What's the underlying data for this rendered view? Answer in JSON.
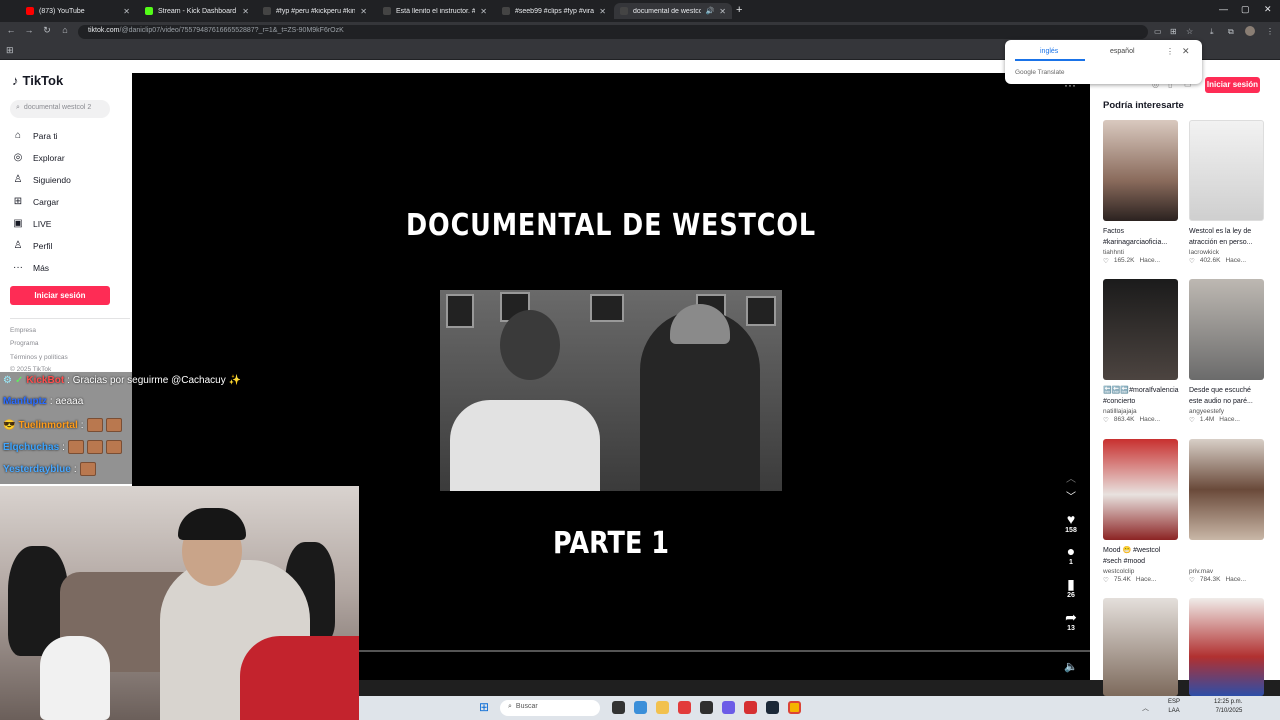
{
  "browser": {
    "tabs": [
      {
        "title": "(873) YouTube",
        "color": "#ff0000"
      },
      {
        "title": "Stream - Kick Dashboard",
        "color": "#53fc18"
      },
      {
        "title": "#fyp #peru #kickperu #kingtek",
        "color": "#111111"
      },
      {
        "title": "Está llenito el instructor. #fypp",
        "color": "#111111"
      },
      {
        "title": "#seeb99 #clips #fyp #viral #pe",
        "color": "#111111"
      },
      {
        "title": "documental de westcol #d",
        "color": "#111111"
      }
    ],
    "active_tab": 5,
    "url_host": "tiktok.com",
    "url_path": "/@daniclip07/video/7557948761666552887?_r=1&_t=ZS-90M9kF6rOzK"
  },
  "tiktok": {
    "logo": "TikTok",
    "search_placeholder": "documental westcol 2",
    "nav": [
      {
        "label": "Para ti",
        "icon": "home-icon"
      },
      {
        "label": "Explorar",
        "icon": "compass-icon"
      },
      {
        "label": "Siguiendo",
        "icon": "following-icon"
      },
      {
        "label": "Cargar",
        "icon": "upload-icon"
      },
      {
        "label": "LIVE",
        "icon": "live-icon"
      },
      {
        "label": "Perfil",
        "icon": "profile-icon"
      },
      {
        "label": "Más",
        "icon": "more-icon"
      }
    ],
    "login_label": "Iniciar sesión",
    "footer": [
      "Empresa",
      "Programa",
      "Términos y políticas",
      "© 2025 TikTok"
    ],
    "video": {
      "title": "DOCUMENTAL DE WESTCOL",
      "subtitle": "PARTE 1",
      "likes": "158",
      "comments": "1",
      "saves": "26",
      "shares": "13"
    },
    "suggest_heading": "Podría interesarte",
    "cards": [
      {
        "title": "Factos #karinagarciaoficia...",
        "user": "tiahhnti",
        "likes": "165.2K",
        "ago": "Hace...",
        "color": "#8a6b5c"
      },
      {
        "title": "Westcol es la ley de atracción en perso...",
        "user": "lacrowkick",
        "likes": "402.6K",
        "ago": "Hace...",
        "color": "#e6e6e6"
      },
      {
        "title": "🔚🔚🔚#moraIfvalencia #concierto",
        "user": "natilllajajaja",
        "likes": "863.4K",
        "ago": "Hace...",
        "color": "#3a3a3a"
      },
      {
        "title": "Desde que escuché este audio no paré...",
        "user": "angyeestefy",
        "likes": "1.4M",
        "ago": "Hace...",
        "color": "#6b6b6b"
      },
      {
        "title": "Mood 😁 #westcol #sech #mood",
        "user": "westcolclip",
        "likes": "75.4K",
        "ago": "Hace...",
        "color": "#9c2c2c"
      },
      {
        "title": "",
        "user": "priv.mav",
        "likes": "784.3K",
        "ago": "Hace...",
        "color": "#c9b7a7"
      },
      {
        "title": "",
        "user": "",
        "likes": "",
        "ago": "",
        "color": "#7d6a5c"
      },
      {
        "title": "",
        "user": "",
        "likes": "",
        "ago": "",
        "color": "#d0c6c0"
      }
    ]
  },
  "translate": {
    "lang1": "inglés",
    "lang2": "español",
    "brand": "Google Translate"
  },
  "chat": [
    {
      "user": "KickBot",
      "msg": ": Gracias por seguirme @Cachacuy ✨",
      "color": "#ff4d4d"
    },
    {
      "user": "Manfuptz",
      "msg": ": aeaaa",
      "color": "#2b6cff"
    },
    {
      "user": "Tuelinmortal",
      "msg": ":",
      "color": "#ff9c1a"
    },
    {
      "user": "Elqchuchas",
      "msg": ":",
      "color": "#3da5ff"
    },
    {
      "user": "Yesterdayblue",
      "msg": ":",
      "color": "#4aa8ff"
    }
  ],
  "taskbar": {
    "search": "Buscar",
    "lang_top": "ESP",
    "lang_bottom": "LAA",
    "time": "12:25 p.m.",
    "date": "7/10/2025"
  }
}
